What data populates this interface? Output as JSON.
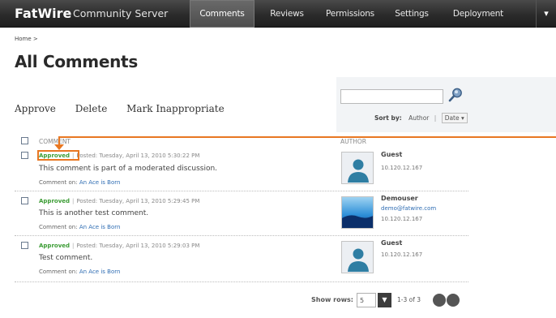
{
  "header": {
    "brand": "FatWire",
    "product": "Community Server",
    "nav": [
      {
        "label": "Comments",
        "active": true
      },
      {
        "label": "Reviews",
        "active": false
      },
      {
        "label": "Permissions",
        "active": false
      },
      {
        "label": "Settings",
        "active": false
      },
      {
        "label": "Deployment",
        "active": false
      }
    ],
    "menu_icon": "chevron-down-icon"
  },
  "breadcrumb": "Home >",
  "page_title": "All Comments",
  "actions": {
    "approve": "Approve",
    "delete": "Delete",
    "mark_inappropriate": "Mark Inappropriate"
  },
  "search": {
    "placeholder": "",
    "icon": "search-icon"
  },
  "sort": {
    "label": "Sort by:",
    "author": "Author",
    "separator": "|",
    "date": "Date ▾"
  },
  "list": {
    "col_comment": "COMMENT",
    "col_author": "AUTHOR",
    "rows": [
      {
        "status": "Approved",
        "posted": "Posted: Tuesday, April 13, 2010 5:30:22 PM",
        "text": "This comment is part of a moderated discussion.",
        "comment_on_label": "Comment on:",
        "comment_on_link": "An Ace is Born",
        "author": "Guest",
        "email": "",
        "ip": "10.120.12.167",
        "avatar": "guest-avatar-icon"
      },
      {
        "status": "Approved",
        "posted": "Posted: Tuesday, April 13, 2010 5:29:45 PM",
        "text": "This is another test comment.",
        "comment_on_label": "Comment on:",
        "comment_on_link": "An Ace is Born",
        "author": "Demouser",
        "email": "demo@fatwire.com",
        "ip": "10.120.12.167",
        "avatar": "landscape-avatar-image"
      },
      {
        "status": "Approved",
        "posted": "Posted: Tuesday, April 13, 2010 5:29:03 PM",
        "text": "Test comment.",
        "comment_on_label": "Comment on:",
        "comment_on_link": "An Ace is Born",
        "author": "Guest",
        "email": "",
        "ip": "10.120.12.167",
        "avatar": "guest-avatar-icon"
      }
    ]
  },
  "pager": {
    "label": "Show rows:",
    "rows_value": "5",
    "range": "1-3 of 3"
  },
  "colors": {
    "approved": "#3b9c34",
    "link": "#2f6db3",
    "callout": "#e87722",
    "nav_bg": "#2b2b2b"
  }
}
